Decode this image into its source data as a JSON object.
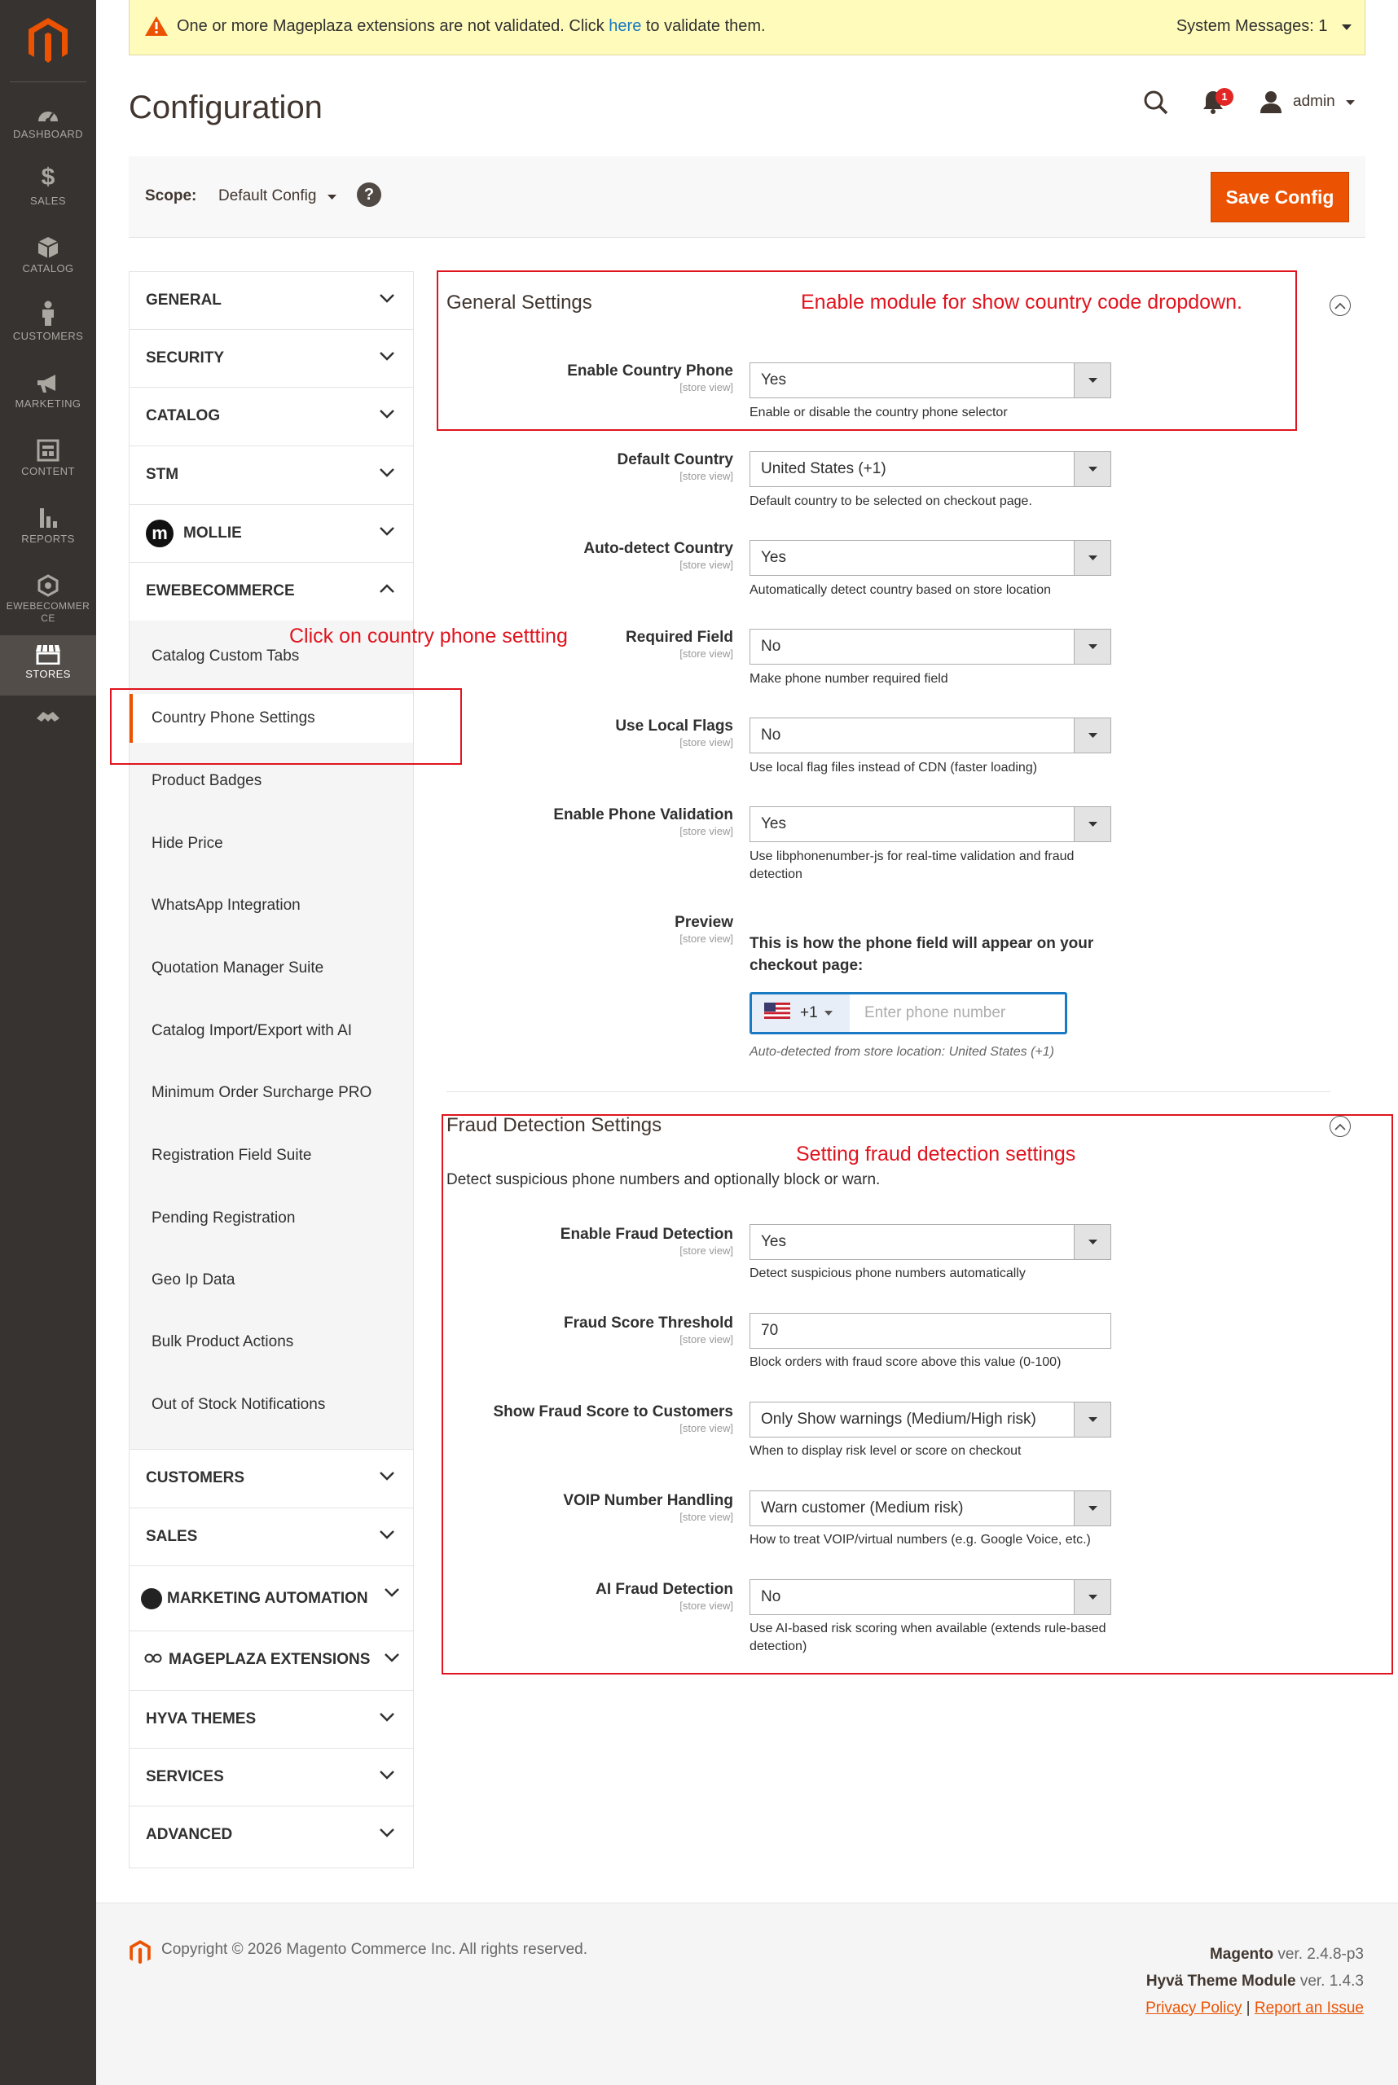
{
  "nav": {
    "items": [
      {
        "label": "DASHBOARD",
        "icon": "dashboard-icon"
      },
      {
        "label": "SALES",
        "icon": "dollar-icon"
      },
      {
        "label": "CATALOG",
        "icon": "cube-icon"
      },
      {
        "label": "CUSTOMERS",
        "icon": "person-icon"
      },
      {
        "label": "MARKETING",
        "icon": "megaphone-icon"
      },
      {
        "label": "CONTENT",
        "icon": "layout-icon"
      },
      {
        "label": "REPORTS",
        "icon": "bar-chart-icon"
      },
      {
        "label": "EWEBECOMMERCE",
        "icon": "hexagon-icon"
      },
      {
        "label": "STORES",
        "icon": "store-icon"
      },
      {
        "label": "",
        "icon": "puzzle-icon"
      }
    ]
  },
  "system_message": {
    "text_before": "One or more Mageplaza extensions are not validated. Click ",
    "link": "here",
    "text_after": " to validate them.",
    "count_label": "System Messages: 1"
  },
  "header": {
    "title": "Configuration",
    "notification_count": "1",
    "user": "admin"
  },
  "scope": {
    "label": "Scope:",
    "value": "Default Config",
    "help": "?",
    "save_label": "Save Config"
  },
  "tabs": {
    "top": [
      "GENERAL",
      "SECURITY",
      "CATALOG",
      "STM",
      "MOLLIE",
      "EWEBECOMMERCE"
    ],
    "sub_items": [
      "Catalog Custom Tabs",
      "Country Phone Settings",
      "Product Badges",
      "Hide Price",
      "WhatsApp Integration",
      "Quotation Manager Suite",
      "Catalog Import/Export with AI",
      "Minimum Order Surcharge PRO",
      "Registration Field Suite",
      "Pending Registration",
      "Geo Ip Data",
      "Bulk Product Actions",
      "Out of Stock Notifications"
    ],
    "bottom": [
      "CUSTOMERS",
      "SALES",
      "MARKETING AUTOMATION",
      "MAGEPLAZA EXTENSIONS",
      "HYVA THEMES",
      "SERVICES",
      "ADVANCED"
    ]
  },
  "general": {
    "title": "General Settings",
    "scope_note": "[store view]",
    "fields": [
      {
        "label": "Enable Country Phone",
        "value": "Yes",
        "note": "Enable or disable the country phone selector"
      },
      {
        "label": "Default Country",
        "value": "United States (+1)",
        "note": "Default country to be selected on checkout page."
      },
      {
        "label": "Auto-detect Country",
        "value": "Yes",
        "note": "Automatically detect country based on store location"
      },
      {
        "label": "Required Field",
        "value": "No",
        "note": "Make phone number required field"
      },
      {
        "label": "Use Local Flags",
        "value": "No",
        "note": "Use local flag files instead of CDN (faster loading)"
      },
      {
        "label": "Enable Phone Validation",
        "value": "Yes",
        "note": "Use libphonenumber-js for real-time validation and fraud detection"
      }
    ],
    "preview": {
      "label": "Preview",
      "text": "This is how the phone field will appear on your checkout page:",
      "dial_code": "+1",
      "placeholder": "Enter phone number",
      "auto_note": "Auto-detected from store location: United States (+1)"
    }
  },
  "fraud": {
    "title": "Fraud Detection Settings",
    "description": "Detect suspicious phone numbers and optionally block or warn.",
    "fields": [
      {
        "label": "Enable Fraud Detection",
        "value": "Yes",
        "note": "Detect suspicious phone numbers automatically"
      },
      {
        "label": "Fraud Score Threshold",
        "value": "70",
        "note": "Block orders with fraud score above this value (0-100)"
      },
      {
        "label": "Show Fraud Score to Customers",
        "value": "Only Show warnings (Medium/High risk)",
        "note": "When to display risk level or score on checkout"
      },
      {
        "label": "VOIP Number Handling",
        "value": "Warn customer (Medium risk)",
        "note": "How to treat VOIP/virtual numbers (e.g. Google Voice, etc.)"
      },
      {
        "label": "AI Fraud Detection",
        "value": "No",
        "note": "Use AI-based risk scoring when available (extends rule-based detection)"
      }
    ]
  },
  "annotations": {
    "general": "Enable module for show country code dropdown.",
    "tab": "Click on country phone settting",
    "fraud": "Setting fraud detection settings"
  },
  "footer": {
    "copyright": "Copyright © 2026 Magento Commerce Inc. All rights reserved.",
    "magento_name": "Magento",
    "magento_ver": " ver. 2.4.8-p3",
    "hyva_name": "Hyvä Theme Module",
    "hyva_ver": " ver. 1.4.3",
    "privacy": "Privacy Policy",
    "separator": "|",
    "report": "Report an Issue"
  },
  "colors": {
    "accent": "#eb5202",
    "nav_bg": "#373330",
    "annotation_red": "#e0141e",
    "message_bg": "#fffbbb"
  }
}
